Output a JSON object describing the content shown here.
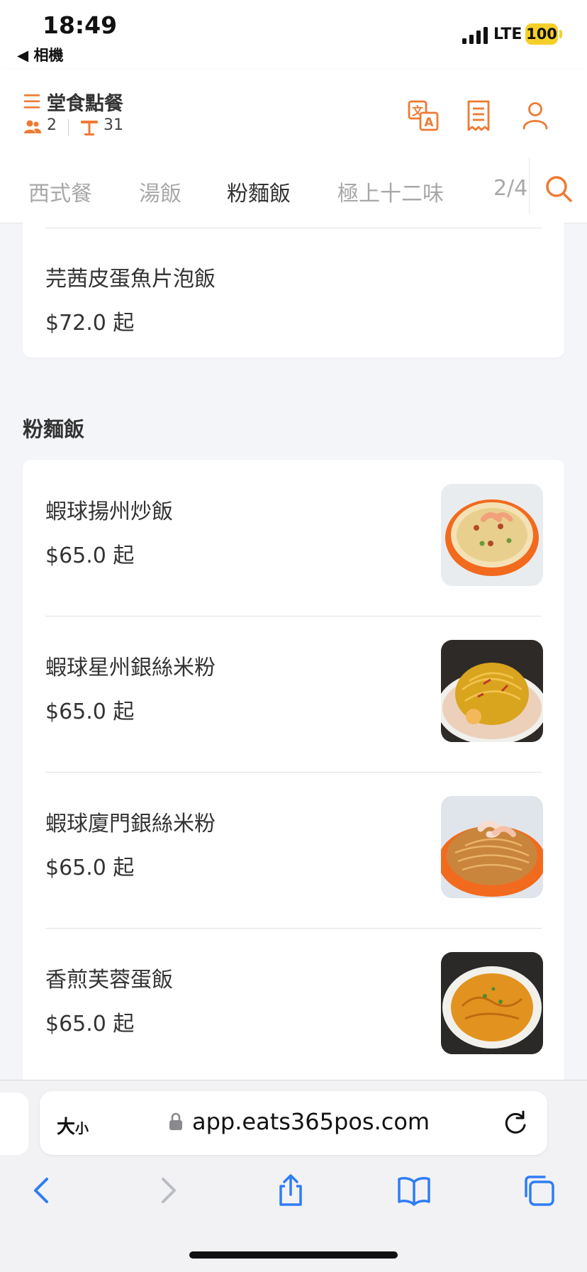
{
  "status_bar": {
    "time": "18:49",
    "back_label": "◀ 相機",
    "network": "LTE",
    "battery": "100"
  },
  "header": {
    "title": "堂食點餐",
    "people_count": "2",
    "table_number": "31"
  },
  "tabs": [
    {
      "label": "西式餐",
      "active": false
    },
    {
      "label": "湯飯",
      "active": false
    },
    {
      "label": "粉麵飯",
      "active": true
    },
    {
      "label": "極上十二味",
      "active": false
    },
    {
      "label": "2/4",
      "active": false
    }
  ],
  "prev_section": {
    "items": [
      {
        "name": "芫茜皮蛋魚片泡飯",
        "price": "$72.0 起"
      }
    ]
  },
  "section": {
    "title": "粉麵飯",
    "items": [
      {
        "name": "蝦球揚州炒飯",
        "price": "$65.0 起",
        "image_icon": "yangzhou-fried-rice-photo"
      },
      {
        "name": "蝦球星州銀絲米粉",
        "price": "$65.0 起",
        "image_icon": "singapore-noodles-photo"
      },
      {
        "name": "蝦球廈門銀絲米粉",
        "price": "$65.0 起",
        "image_icon": "xiamen-noodles-photo"
      },
      {
        "name": "香煎芙蓉蛋飯",
        "price": "$65.0 起",
        "image_icon": "egg-foo-young-rice-photo"
      }
    ]
  },
  "browser": {
    "text_size_label": "大",
    "text_size_small": "小",
    "url": "app.eats365pos.com"
  },
  "colors": {
    "accent": "#ee7a33",
    "text": "#333333",
    "muted_tab": "#a8a8a8"
  }
}
